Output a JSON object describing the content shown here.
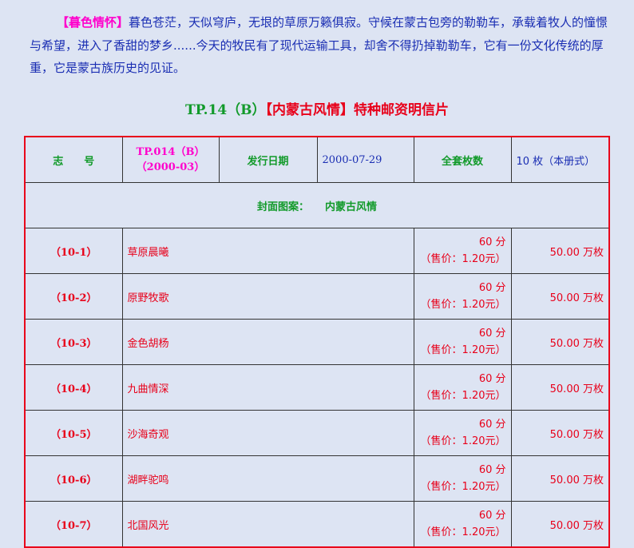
{
  "intro": {
    "tag": "【暮色情怀】",
    "text": "暮色苍茫，天似穹庐，无垠的草原万籁俱寂。守候在蒙古包旁的勒勒车，承载着牧人的憧憬与希望，进入了香甜的梦乡......今天的牧民有了现代运输工具，却舍不得扔掉勒勒车，它有一份文化传统的厚重，它是蒙古族历史的见证。"
  },
  "title": {
    "code": "TP.14（B）",
    "name": "【内蒙古风情】特种邮资明信片"
  },
  "info": {
    "zhi_label": "志　　号",
    "zhi_value_line1": "TP.014（B）",
    "zhi_value_line2": "（2000-03）",
    "date_label": "发行日期",
    "date_value": "2000-07-29",
    "count_label": "全套枚数",
    "count_value": "10 枚（本册式）"
  },
  "cover": {
    "label": "封面图案：",
    "value": "内蒙古风情"
  },
  "cards": [
    {
      "index": "（10-1）",
      "name": "草原晨曦",
      "face": "60 分",
      "sale": "（售价：1.20元）",
      "qty": "50.00 万枚"
    },
    {
      "index": "（10-2）",
      "name": "原野牧歌",
      "face": "60 分",
      "sale": "（售价：1.20元）",
      "qty": "50.00 万枚"
    },
    {
      "index": "（10-3）",
      "name": "金色胡杨",
      "face": "60 分",
      "sale": "（售价：1.20元）",
      "qty": "50.00 万枚"
    },
    {
      "index": "（10-4）",
      "name": "九曲情深",
      "face": "60 分",
      "sale": "（售价：1.20元）",
      "qty": "50.00 万枚"
    },
    {
      "index": "（10-5）",
      "name": "沙海奇观",
      "face": "60 分",
      "sale": "（售价：1.20元）",
      "qty": "50.00 万枚"
    },
    {
      "index": "（10-6）",
      "name": "湖畔驼鸣",
      "face": "60 分",
      "sale": "（售价：1.20元）",
      "qty": "50.00 万枚"
    },
    {
      "index": "（10-7）",
      "name": "北国风光",
      "face": "60 分",
      "sale": "（售价：1.20元）",
      "qty": "50.00 万枚"
    }
  ]
}
